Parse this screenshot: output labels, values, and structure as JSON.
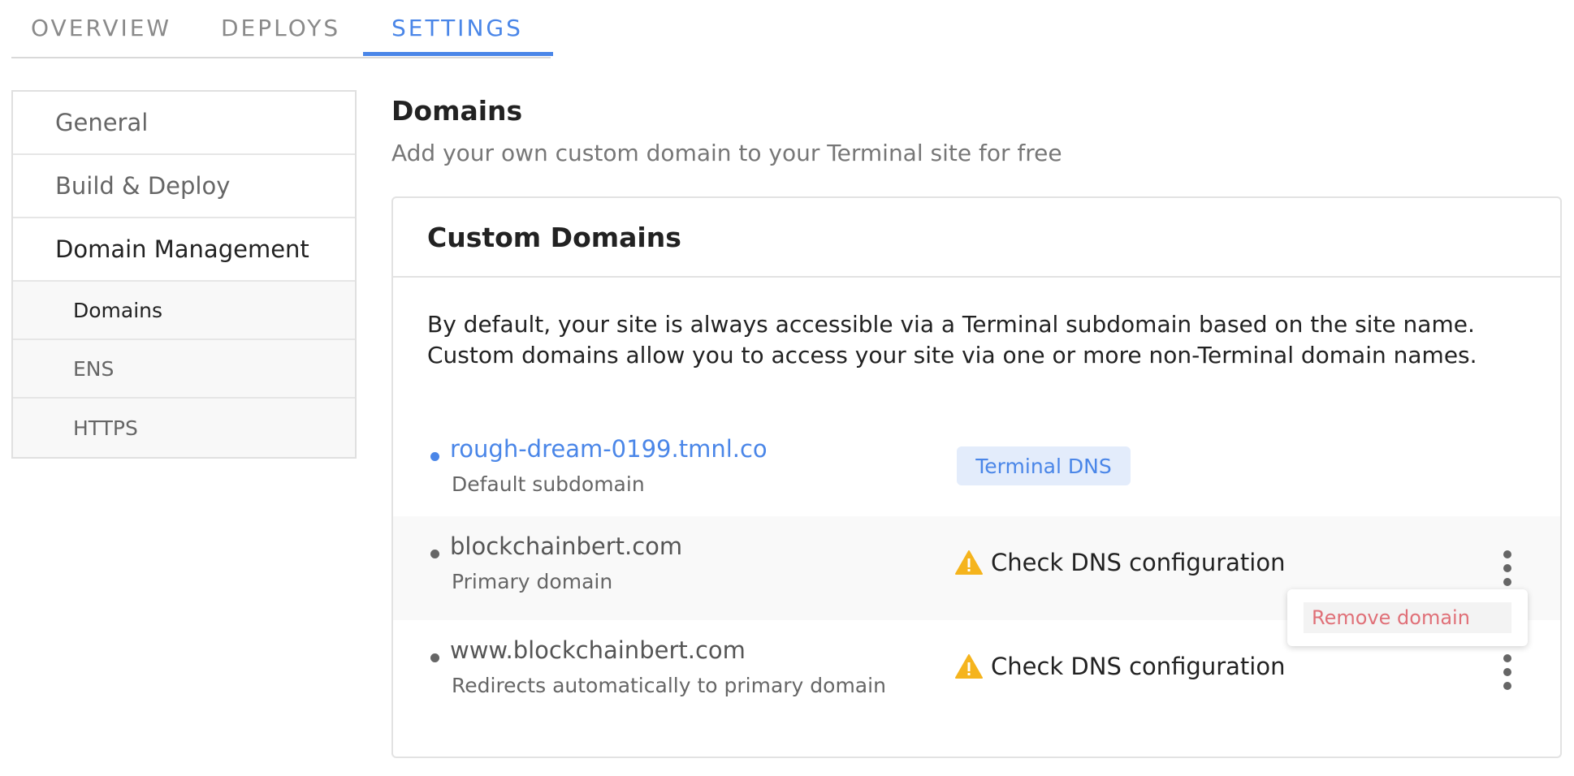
{
  "tabs": [
    {
      "label": "OVERVIEW"
    },
    {
      "label": "DEPLOYS"
    },
    {
      "label": "SETTINGS"
    }
  ],
  "sidebar": {
    "items": [
      {
        "label": "General"
      },
      {
        "label": "Build & Deploy"
      },
      {
        "label": "Domain Management"
      }
    ],
    "subitems": [
      {
        "label": "Domains"
      },
      {
        "label": "ENS"
      },
      {
        "label": "HTTPS"
      }
    ]
  },
  "main": {
    "title": "Domains",
    "subtitle": "Add your own custom domain to your Terminal site for free"
  },
  "card": {
    "title": "Custom Domains",
    "description": "By default, your site is always accessible via a Terminal subdomain based on the site name. Custom domains allow you to access your site via one or more non-Terminal domain names.",
    "domains": [
      {
        "name": "rough-dream-0199.tmnl.co",
        "desc": "Default subdomain",
        "badge": "Terminal DNS"
      },
      {
        "name": "blockchainbert.com",
        "desc": "Primary domain",
        "status": "Check DNS configuration"
      },
      {
        "name": "www.blockchainbert.com",
        "desc": "Redirects automatically to primary domain",
        "status": "Check DNS configuration"
      }
    ],
    "menu": {
      "remove_label": "Remove domain"
    }
  },
  "colors": {
    "accent": "#4a86e8",
    "warning": "#f5b41d",
    "danger": "#e07078"
  },
  "icons": [
    "warning-icon",
    "more-vertical-icon",
    "bullet-icon"
  ]
}
